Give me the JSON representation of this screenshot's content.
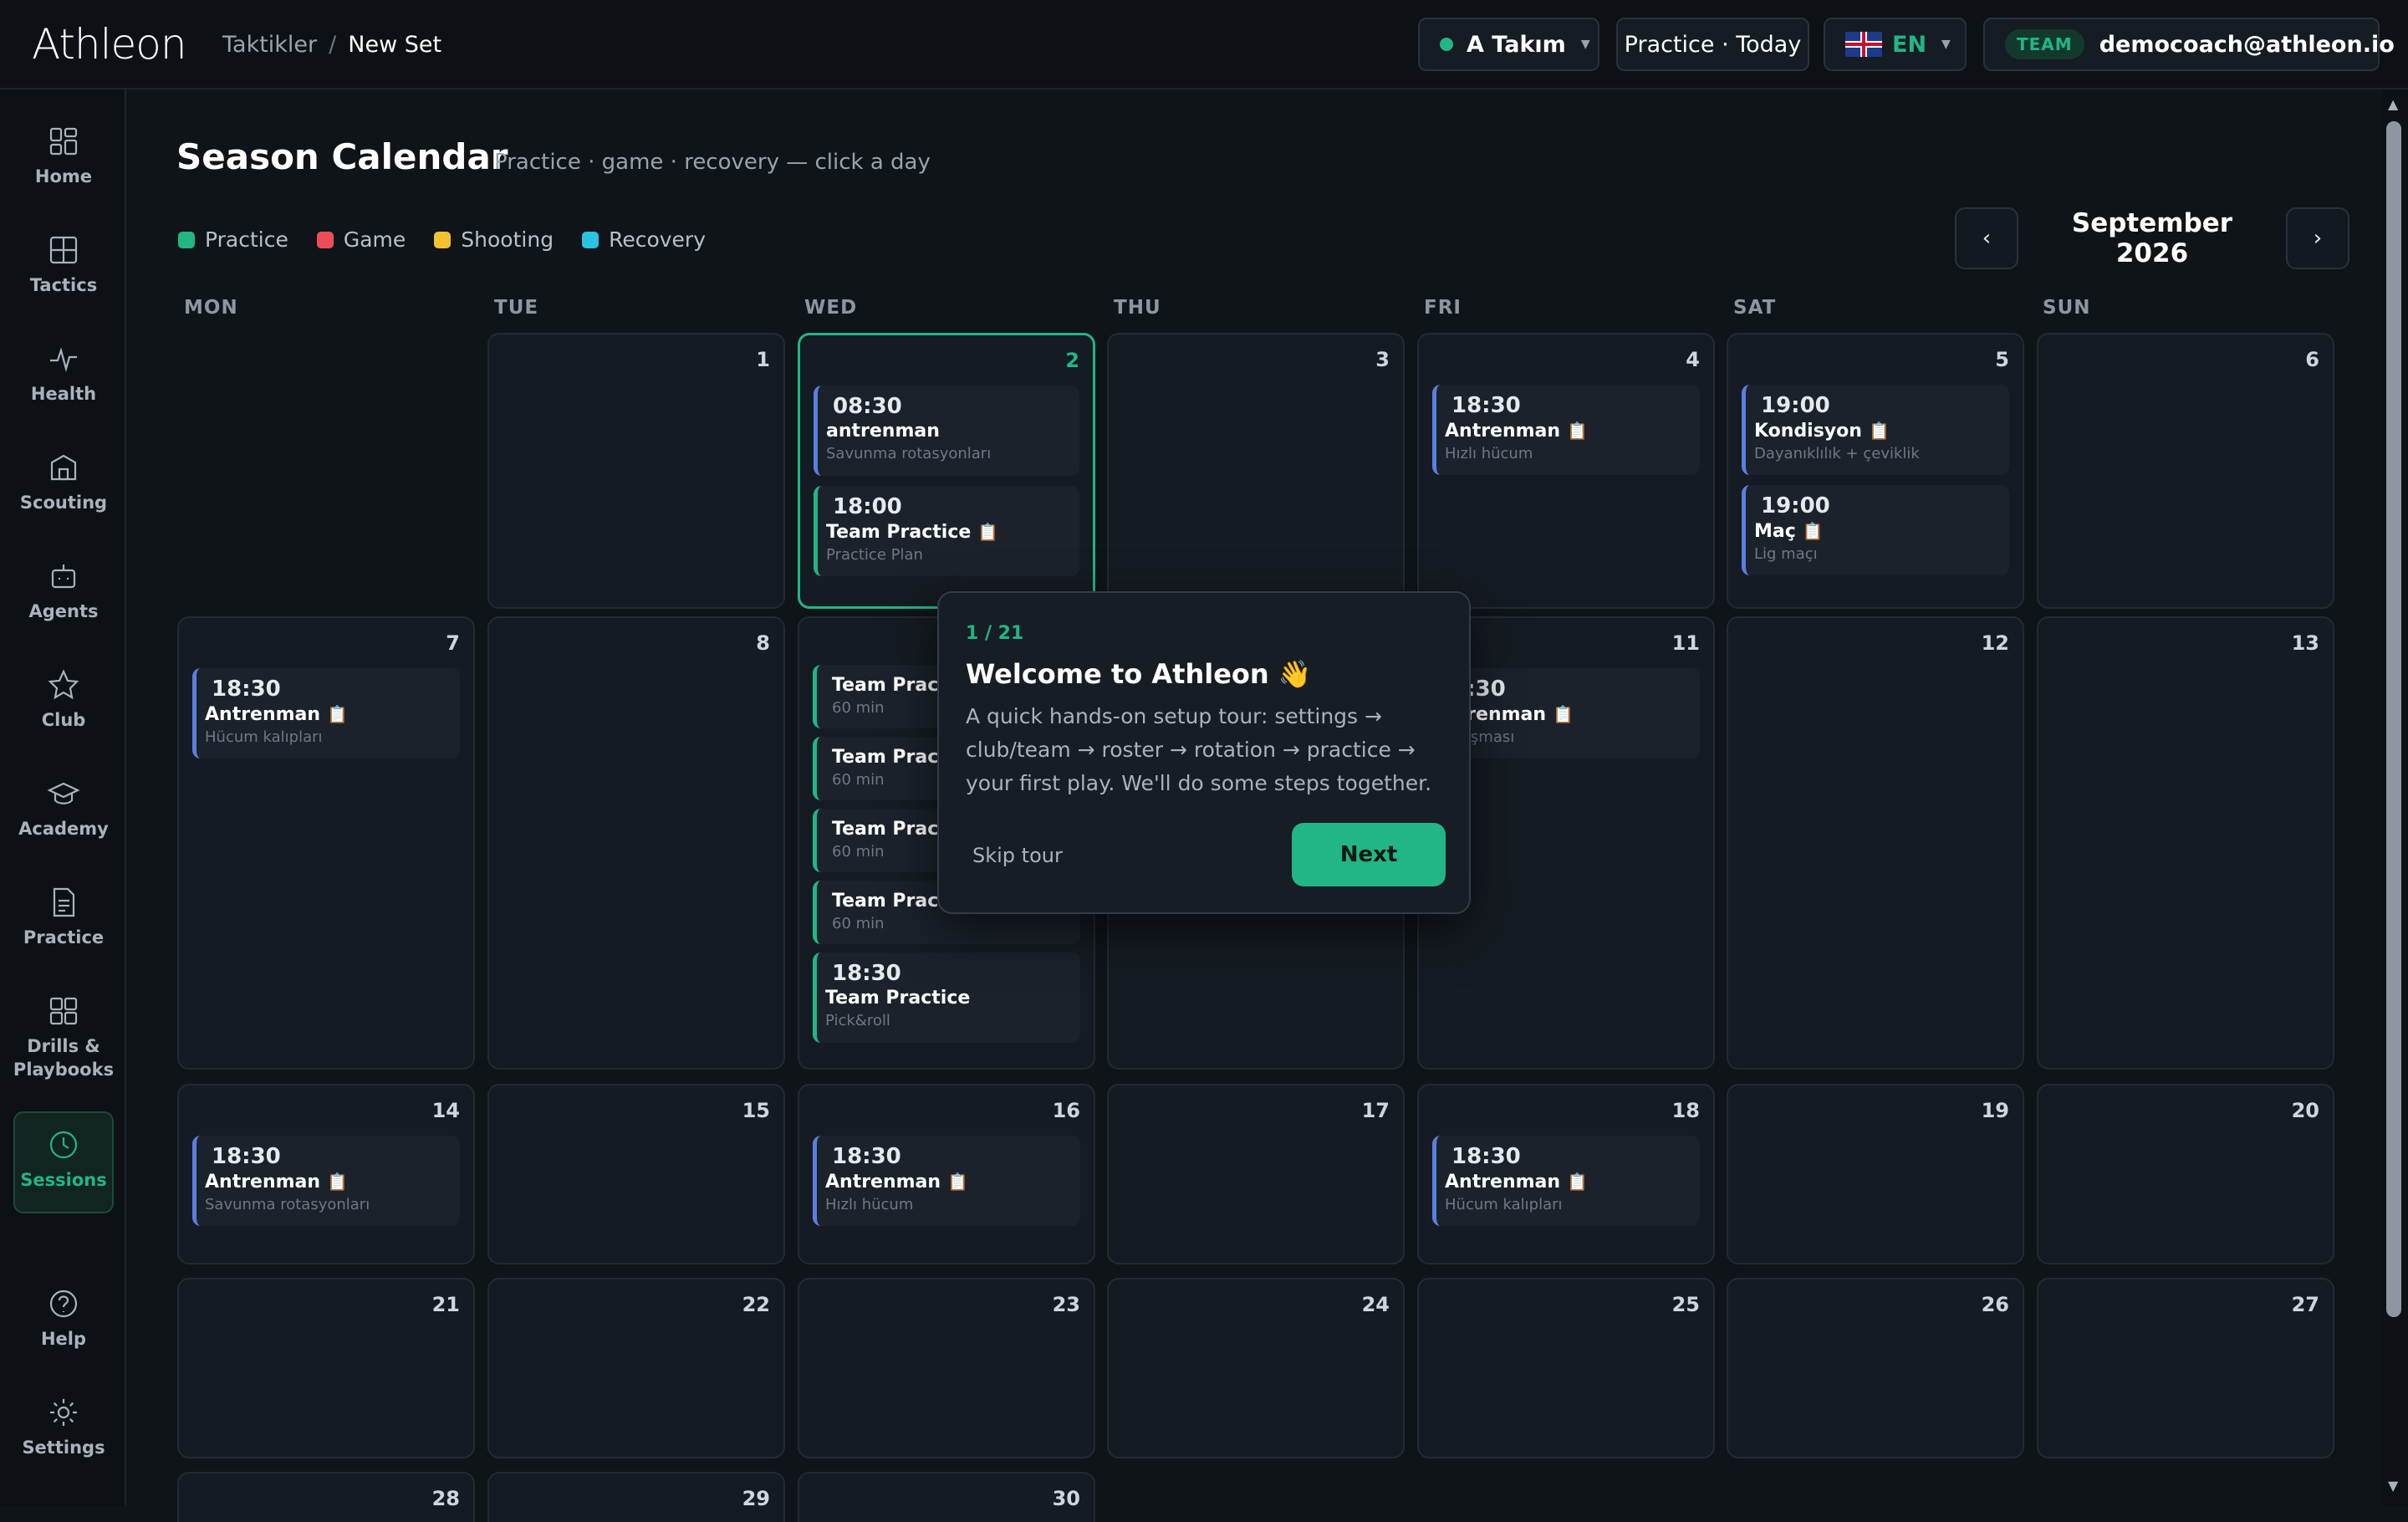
{
  "header": {
    "logo": "Athleon",
    "breadcrumb": [
      "Taktikler",
      "New Set"
    ],
    "team_selector": "A Takım",
    "practice_button": "Practice · Today",
    "language": "EN",
    "role_badge": "TEAM",
    "user_email": "democoach@athleon.io"
  },
  "sidebar": {
    "items": [
      {
        "label": "Home",
        "icon": "grid-icon"
      },
      {
        "label": "Tactics",
        "icon": "board-icon"
      },
      {
        "label": "Health",
        "icon": "pulse-icon"
      },
      {
        "label": "Scouting",
        "icon": "building-icon"
      },
      {
        "label": "Agents",
        "icon": "robot-icon"
      },
      {
        "label": "Club",
        "icon": "star-icon"
      },
      {
        "label": "Academy",
        "icon": "graduation-cap-icon"
      },
      {
        "label": "Practice",
        "icon": "document-icon"
      },
      {
        "label": "Drills & Playbooks",
        "icon": "grid-icon"
      },
      {
        "label": "Sessions",
        "icon": "clock-icon",
        "active": true
      },
      {
        "label": "Help",
        "icon": "help-icon"
      },
      {
        "label": "Settings",
        "icon": "gear-icon"
      }
    ]
  },
  "calendar": {
    "title": "Season Calendar",
    "subtitle": "Practice · game · recovery — click a day",
    "legend": [
      {
        "label": "Practice",
        "color": "#22b585"
      },
      {
        "label": "Game",
        "color": "#ef4c5a"
      },
      {
        "label": "Shooting",
        "color": "#f2c230"
      },
      {
        "label": "Recovery",
        "color": "#2bc3e0"
      }
    ],
    "month": "September 2026",
    "prev": "‹",
    "next": "›",
    "weekdays": [
      "MON",
      "TUE",
      "WED",
      "THU",
      "FRI",
      "SAT",
      "SUN"
    ],
    "days": {
      "d1": "1",
      "d2": "2",
      "d3": "3",
      "d4": "4",
      "d5": "5",
      "d6": "6",
      "d7": "7",
      "d8": "8",
      "d11": "11",
      "d12": "12",
      "d13": "13",
      "d14": "14",
      "d15": "15",
      "d16": "16",
      "d17": "17",
      "d18": "18",
      "d19": "19",
      "d20": "20",
      "d21": "21",
      "d22": "22",
      "d23": "23",
      "d24": "24",
      "d25": "25",
      "d26": "26",
      "d27": "27",
      "d28": "28",
      "d29": "29",
      "d30": "30"
    },
    "events": {
      "e2a": {
        "time": "08:30",
        "title": "antrenman",
        "sub": "Savunma rotasyonları"
      },
      "e2b": {
        "time": "18:00",
        "title": "Team Practice",
        "sub": "Practice Plan"
      },
      "e4a": {
        "time": "18:30",
        "title": "Antrenman",
        "sub": "Hızlı hücum"
      },
      "e5a": {
        "time": "19:00",
        "title": "Kondisyon",
        "sub": "Dayanıklılık + çeviklik"
      },
      "e5b": {
        "time": "19:00",
        "title": "Maç",
        "sub": "Lig maçı"
      },
      "e7a": {
        "time": "18:30",
        "title": "Antrenman",
        "sub": "Hücum kalıpları"
      },
      "e9a": {
        "title": "Team Practic",
        "sub": "60 min"
      },
      "e9b": {
        "title": "Team Practic",
        "sub": "60 min"
      },
      "e9c": {
        "title": "Team Practic",
        "sub": "60 min"
      },
      "e9d": {
        "title": "Team Practic",
        "sub": "60 min"
      },
      "e9e": {
        "time": "18:30",
        "title": "Team Practice",
        "sub": "Pick&roll"
      },
      "e11a": {
        "time": "8:30",
        "title": "ntrenman",
        "sub": "çalışması"
      },
      "e14a": {
        "time": "18:30",
        "title": "Antrenman",
        "sub": "Savunma rotasyonları"
      },
      "e16a": {
        "time": "18:30",
        "title": "Antrenman",
        "sub": "Hızlı hücum"
      },
      "e18a": {
        "time": "18:30",
        "title": "Antrenman",
        "sub": "Hücum kalıpları"
      }
    },
    "clip_icon": "📋"
  },
  "tour": {
    "step": "1 / 21",
    "title": "Welcome to Athleon",
    "wave": "👋",
    "body": "A quick hands-on setup tour: settings → club/team → roster → rotation → practice → your first play. We'll do some steps together.",
    "skip": "Skip tour",
    "next": "Next"
  }
}
